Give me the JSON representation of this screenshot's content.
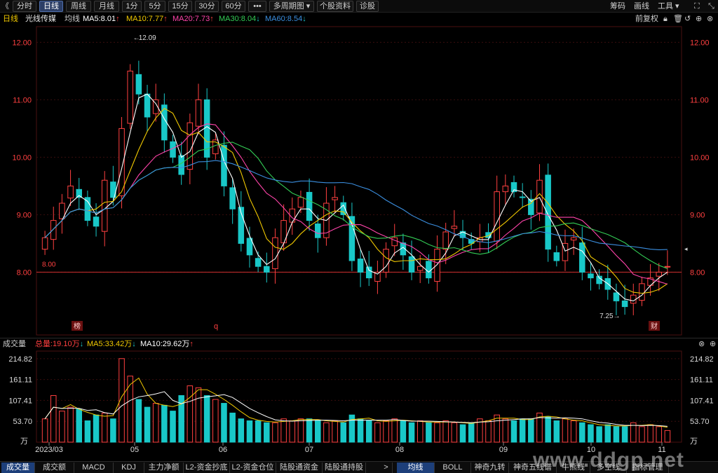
{
  "toolbar": {
    "back_glyph": "《",
    "tabs": [
      "分时",
      "日线",
      "周线",
      "月线",
      "1分",
      "5分",
      "15分",
      "30分",
      "60分",
      "•••",
      "多周期图 ▾",
      "个股资料",
      "诊股"
    ],
    "active_tab": 1,
    "right": [
      "筹码",
      "画线",
      "工具 ▾"
    ]
  },
  "info": {
    "period": "日线",
    "name": "光线传媒",
    "ma_label": "均线",
    "ma5": "MA5:8.01",
    "ma10": "MA10:7.77",
    "ma20": "MA20:7.73",
    "ma30": "MA30:8.04",
    "ma60": "MA60:8.54",
    "adjust": "前复权",
    "arrow_up": "↑",
    "arrow_down": "↓"
  },
  "colors": {
    "up": "#ff4040",
    "down": "#19c8c8",
    "ma5": "#ffffff",
    "ma10": "#f0c800",
    "ma20": "#ff44aa",
    "ma30": "#33cc55",
    "ma60": "#3b8fe0",
    "grid": "#3a0d0d"
  },
  "price_axis": {
    "labels": [
      "12.00",
      "11.00",
      "10.00",
      "9.00",
      "8.00"
    ],
    "values": [
      12,
      11,
      10,
      9,
      8
    ],
    "high_label": "12.09",
    "low_label": "7.25→",
    "ref_label": "8.00",
    "ref_value": 8.0
  },
  "markers": {
    "bang": "榜",
    "q": "q",
    "cai": "财"
  },
  "x_axis": {
    "labels": [
      "2023/03",
      "05",
      "06",
      "07",
      "08",
      "09",
      "10",
      "11"
    ]
  },
  "volume": {
    "title": "成交量",
    "total": "总量:19.10万",
    "ma5": "MA5:33.42万",
    "ma10": "MA10:29.62万",
    "axis_labels": [
      "214.82",
      "161.11",
      "107.41",
      "53.70",
      "万"
    ],
    "axis_values": [
      214.82,
      161.11,
      107.41,
      53.7
    ]
  },
  "bottom_tabs": {
    "left": [
      "成交量",
      "成交额",
      "MACD",
      "KDJ",
      "主力净额",
      "L2-资金抄底",
      "L2-资金仓位",
      "陆股通资金",
      "陆股通持股"
    ],
    "more": ">",
    "right": [
      "均线",
      "BOLL",
      "神奇九转",
      "神奇五线谱",
      "牛熊线",
      "多空线",
      "指标管理"
    ]
  },
  "watermark": "www.ddgp.net",
  "chart_data": {
    "type": "candlestick",
    "title": "光线传媒 日线",
    "x_range": [
      "2023/03",
      "2023/11"
    ],
    "ylim": [
      7.2,
      12.2
    ],
    "notable_points": {
      "high": 12.09,
      "low": 7.25
    },
    "ma_latest": {
      "MA5": 8.01,
      "MA10": 7.77,
      "MA20": 7.73,
      "MA30": 8.04,
      "MA60": 8.54
    },
    "close_series": [
      8.6,
      8.9,
      9.2,
      9.5,
      9.3,
      8.9,
      8.8,
      9.6,
      9.3,
      10.5,
      11.5,
      11.1,
      10.7,
      11.0,
      10.3,
      10.0,
      9.7,
      10.6,
      11.0,
      10.0,
      10.3,
      9.5,
      9.1,
      8.5,
      8.3,
      8.1,
      8.0,
      8.6,
      8.9,
      9.1,
      9.3,
      8.9,
      8.6,
      9.2,
      9.3,
      9.0,
      8.2,
      8.0,
      7.9,
      8.0,
      8.4,
      8.6,
      8.3,
      8.0,
      8.1,
      7.9,
      8.4,
      8.7,
      8.8,
      8.6,
      8.5,
      8.6,
      8.6,
      9.4,
      9.5,
      9.4,
      9.3,
      9.0,
      9.6,
      8.4,
      8.2,
      8.5,
      8.6,
      8.0,
      7.9,
      7.8,
      7.7,
      7.5,
      7.4,
      7.6,
      7.8,
      7.9,
      8.0,
      8.1
    ],
    "volume_series": [
      60,
      120,
      80,
      90,
      85,
      55,
      70,
      75,
      60,
      215,
      170,
      110,
      90,
      100,
      95,
      80,
      120,
      145,
      140,
      120,
      110,
      100,
      75,
      60,
      55,
      55,
      50,
      50,
      60,
      55,
      60,
      60,
      55,
      50,
      55,
      50,
      70,
      60,
      55,
      50,
      55,
      60,
      55,
      50,
      55,
      50,
      50,
      55,
      50,
      45,
      50,
      60,
      55,
      70,
      60,
      55,
      60,
      60,
      75,
      65,
      55,
      60,
      55,
      50,
      45,
      40,
      45,
      40,
      40,
      50,
      40,
      45,
      40,
      30
    ]
  }
}
